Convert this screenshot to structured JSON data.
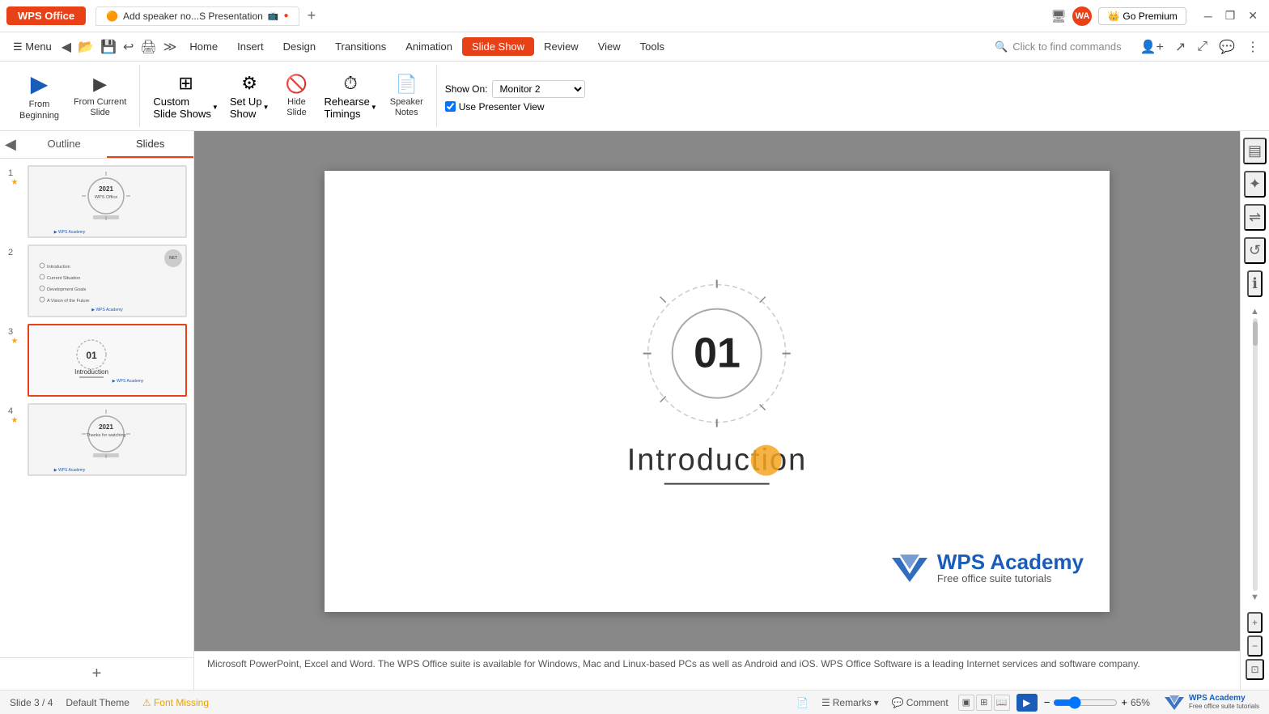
{
  "titlebar": {
    "wps_label": "WPS Office",
    "doc_title": "Add speaker no...S Presentation",
    "add_tab": "+",
    "premium_label": "Go Premium",
    "window_min": "─",
    "window_restore": "❐",
    "window_close": "✕",
    "avatar_initials": "WA",
    "monitor_icon": "🖥",
    "share_icon": "⊞"
  },
  "ribbon": {
    "menu_label": "☰ Menu",
    "tabs": [
      {
        "id": "home",
        "label": "Home"
      },
      {
        "id": "insert",
        "label": "Insert"
      },
      {
        "id": "design",
        "label": "Design"
      },
      {
        "id": "transitions",
        "label": "Transitions"
      },
      {
        "id": "animation",
        "label": "Animation"
      },
      {
        "id": "slideshow",
        "label": "Slide Show",
        "active": true
      },
      {
        "id": "review",
        "label": "Review"
      },
      {
        "id": "view",
        "label": "View"
      },
      {
        "id": "tools",
        "label": "Tools"
      }
    ],
    "search_placeholder": "Click to find commands"
  },
  "toolbar": {
    "groups": [
      {
        "id": "start",
        "items": [
          {
            "id": "from-beginning",
            "icon": "▶",
            "label": "From\nBeginning",
            "has_arrow": false
          },
          {
            "id": "from-current",
            "icon": "▶",
            "label": "From Current\nSlide",
            "has_arrow": false
          }
        ]
      },
      {
        "id": "setup",
        "items": [
          {
            "id": "custom-slide",
            "icon": "⊞",
            "label": "Custom\nSlide Shows",
            "has_arrow": true
          },
          {
            "id": "set-up",
            "icon": "⚙",
            "label": "Set Up\nShow",
            "has_arrow": true
          },
          {
            "id": "hide-slide",
            "icon": "🚫",
            "label": "Hide\nSlide",
            "has_arrow": false
          },
          {
            "id": "rehearse",
            "icon": "⏱",
            "label": "Rehearse\nTimings",
            "has_arrow": true
          },
          {
            "id": "speaker-notes",
            "icon": "📄",
            "label": "Speaker\nNotes",
            "has_arrow": false
          }
        ]
      },
      {
        "id": "monitor",
        "show_on_label": "Show On:",
        "monitor_value": "Monitor 2",
        "use_presenter_label": "Use Presenter View",
        "use_presenter_checked": true
      }
    ]
  },
  "sidebar": {
    "tabs": [
      {
        "id": "outline",
        "label": "Outline"
      },
      {
        "id": "slides",
        "label": "Slides",
        "active": true
      }
    ],
    "slides": [
      {
        "num": 1,
        "star": true,
        "active": false
      },
      {
        "num": 2,
        "star": false,
        "active": false
      },
      {
        "num": 3,
        "star": true,
        "active": true
      },
      {
        "num": 4,
        "star": true,
        "active": false
      }
    ]
  },
  "slide": {
    "number": "01",
    "title": "Introduction",
    "logo_name": "WPS Academy",
    "logo_sub": "Free office suite tutorials"
  },
  "bottom_text": "Microsoft PowerPoint, Excel and Word. The WPS Office suite is available for Windows, Mac and Linux-based PCs as well as Android and iOS. WPS Office Software is a leading Internet services and software company.",
  "status": {
    "slide_info": "Slide 3 / 4",
    "theme": "Default Theme",
    "font_missing": "⚠ Font Missing",
    "remarks_label": "Remarks",
    "comment_label": "Comment",
    "zoom": "65%",
    "play_icon": "▶"
  }
}
